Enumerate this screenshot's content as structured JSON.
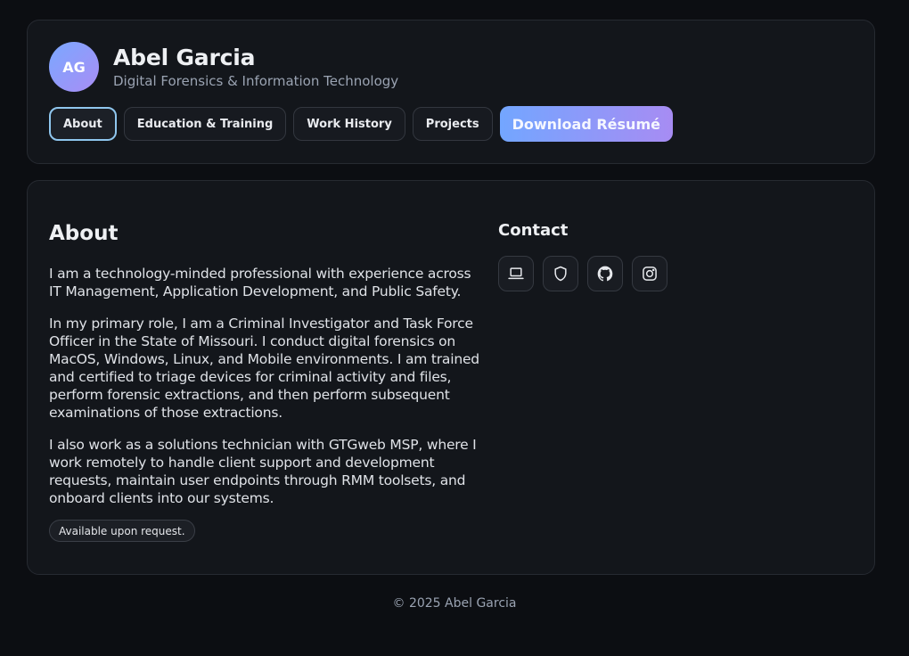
{
  "profile": {
    "initials": "AG",
    "name": "Abel Garcia",
    "subtitle": "Digital Forensics & Information Technology"
  },
  "nav": {
    "items": [
      {
        "label": "About",
        "active": true
      },
      {
        "label": "Education & Training",
        "active": false
      },
      {
        "label": "Work History",
        "active": false
      },
      {
        "label": "Projects",
        "active": false
      }
    ],
    "download_label": "Download Résumé"
  },
  "about": {
    "title": "About",
    "paragraphs": [
      "I am a technology-minded professional with experience across IT Management, Application Development, and Public Safety.",
      "In my primary role, I am a Criminal Investigator and Task Force Officer in the State of Missouri. I conduct digital forensics on MacOS, Windows, Linux, and Mobile environments. I am trained and certified to triage devices for criminal activity and files, perform forensic extractions, and then perform subsequent examinations of those extractions.",
      "I also work as a solutions technician with GTGweb MSP, where I work remotely to handle client support and development requests, maintain user endpoints through RMM toolsets, and onboard clients into our systems."
    ],
    "badge": "Available upon request."
  },
  "contact": {
    "title": "Contact",
    "icons": [
      "laptop-icon",
      "shield-icon",
      "github-icon",
      "instagram-icon"
    ]
  },
  "footer": {
    "text": "© 2025 Abel Garcia"
  },
  "colors": {
    "background": "#0c0e12",
    "card": "#13161b",
    "accent_start": "#73a6ff",
    "accent_end": "#a78cf3",
    "active_border": "#8fc6ee"
  }
}
